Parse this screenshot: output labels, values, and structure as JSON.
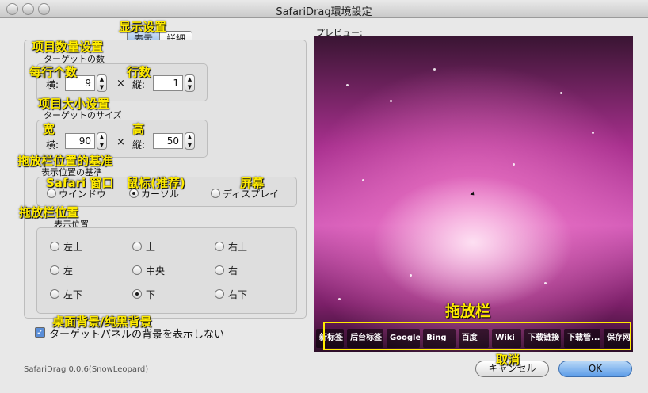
{
  "window": {
    "title": "SafariDrag環境設定"
  },
  "tabs": {
    "display": "表示",
    "detail": "詳細"
  },
  "annotations": {
    "display_settings": "显示设置",
    "item_count_settings": "项目数量设置",
    "per_row_count": "每行个数",
    "row_count": "行数",
    "item_size_settings": "项目大小设置",
    "width": "宽",
    "height": "高",
    "dock_position_basis": "拖放栏位置的基准",
    "safari_window": "Safari 窗口",
    "mouse_recommended": "鼠标(推荐)",
    "screen": "屏幕",
    "dock_position": "拖放栏位置",
    "desktop_bg": "桌面背景/纯黑背景",
    "dock_bar": "拖放栏",
    "cancel": "取消"
  },
  "target_count": {
    "label": "ターゲットの数",
    "horizontal_label": "横:",
    "horizontal_value": "9",
    "times": "×",
    "vertical_label": "縦:",
    "vertical_value": "1"
  },
  "target_size": {
    "label": "ターゲットのサイズ",
    "horizontal_label": "横:",
    "horizontal_value": "90",
    "times": "×",
    "vertical_label": "縦:",
    "vertical_value": "50"
  },
  "basis": {
    "label": "表示位置の基準",
    "options": [
      "ウインドウ",
      "カーソル",
      "ディスプレイ"
    ],
    "selected": "カーソル"
  },
  "position": {
    "label": "表示位置",
    "options": [
      "左上",
      "上",
      "右上",
      "左",
      "中央",
      "右",
      "左下",
      "下",
      "右下"
    ],
    "selected": "下"
  },
  "checkbox": {
    "label": "ターゲットパネルの背景を表示しない",
    "checked": true
  },
  "preview": {
    "label": "プレビュー:",
    "dock_items": [
      "新标签",
      "后台标签",
      "Google",
      "Bing",
      "百度",
      "Wiki",
      "下载链接",
      "下载管...",
      "保存网"
    ]
  },
  "buttons": {
    "cancel": "キャンセル",
    "ok": "OK"
  },
  "version": "SafariDrag 0.0.6(SnowLeopard)"
}
